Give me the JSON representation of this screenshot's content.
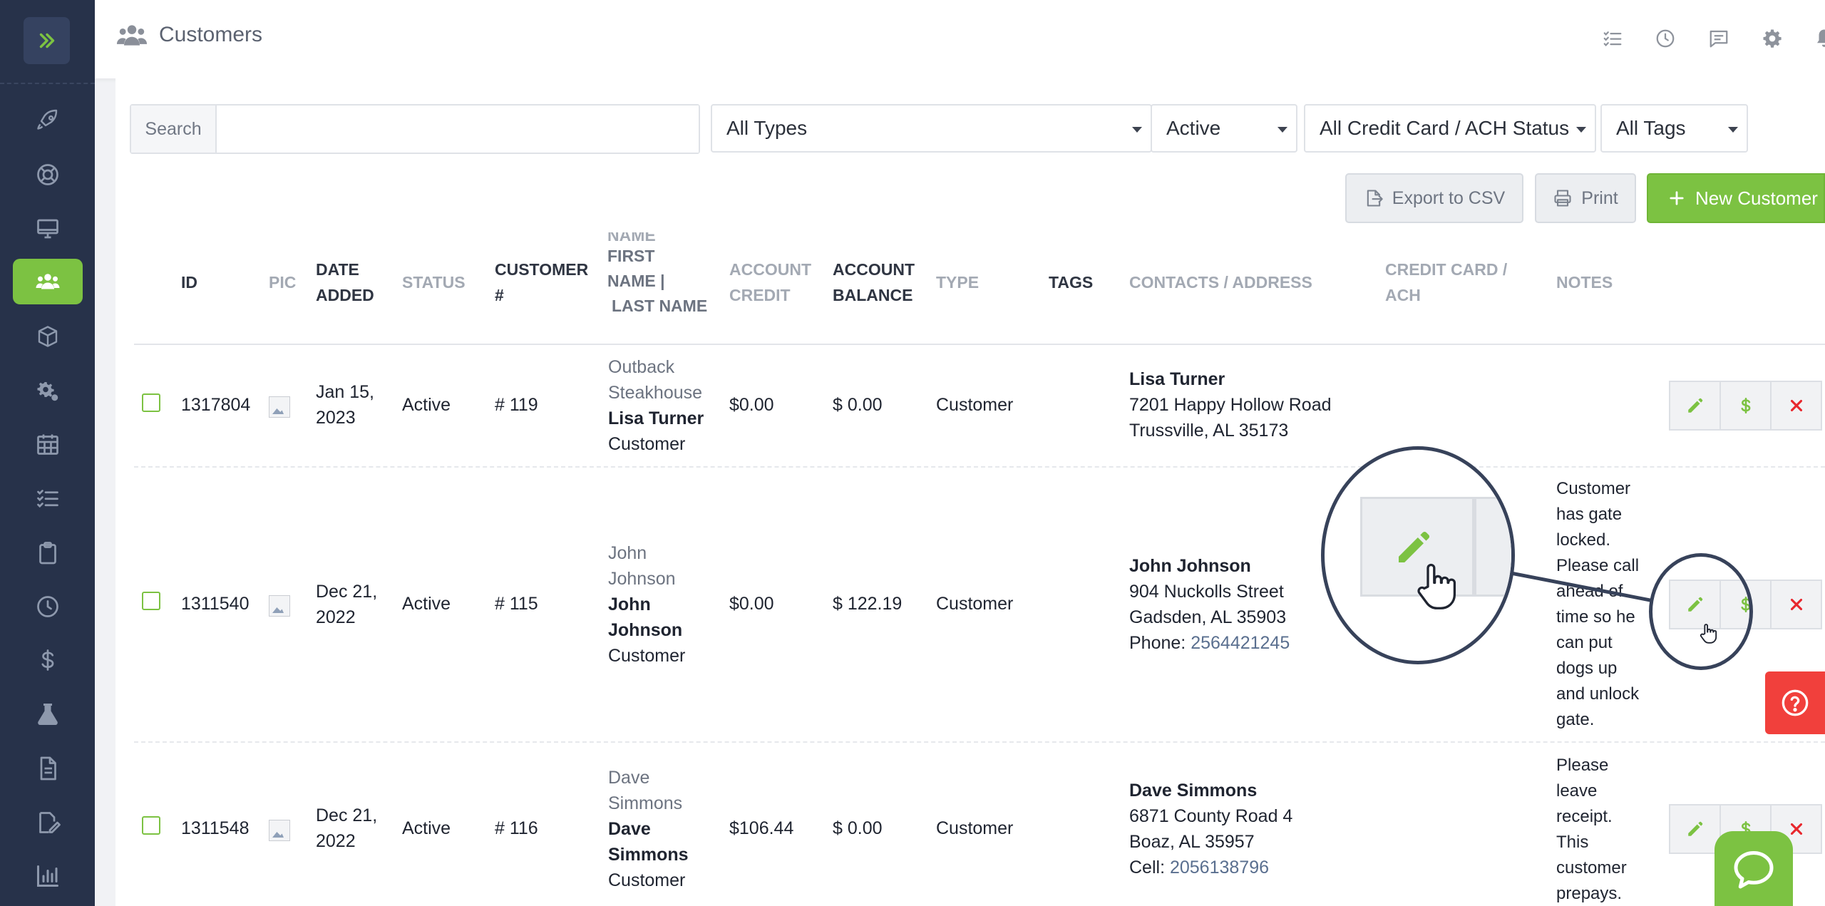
{
  "header": {
    "title": "Customers",
    "icons": [
      "checklist-icon",
      "clock-icon",
      "chat-icon",
      "gear-icon",
      "bell-icon",
      "user-icon"
    ]
  },
  "sidebar": {
    "items": [
      "rocket-icon",
      "lifebuoy-icon",
      "monitor-icon",
      "customers-icon",
      "box-icon",
      "gears-icon",
      "calendar-icon",
      "tasks-icon",
      "clipboard-icon",
      "clock-icon",
      "dollar-icon",
      "flask-icon",
      "document-icon",
      "signature-icon",
      "chart-icon"
    ],
    "active": "customers-icon"
  },
  "filters": {
    "search_label": "Search",
    "search_value": "",
    "type": "All Types",
    "status": "Active",
    "credit": "All Credit Card / ACH Status",
    "tags": "All Tags"
  },
  "toolbar": {
    "export": "Export to CSV",
    "print": "Print",
    "new_customer": "New Customer"
  },
  "table": {
    "headers": {
      "id": "ID",
      "pic": "PIC",
      "date_added_1": "DATE",
      "date_added_2": "ADDED",
      "status": "STATUS",
      "customer_1": "CUSTOMER",
      "customer_2": "#",
      "name_0": "NAME",
      "name_1": "FIRST",
      "name_2": "NAME |",
      "name_3": "LAST NAME",
      "credit_1": "ACCOUNT",
      "credit_2": "CREDIT",
      "balance_1": "ACCOUNT",
      "balance_2": "BALANCE",
      "type": "TYPE",
      "tags": "TAGS",
      "contacts": "CONTACTS / ADDRESS",
      "cc_1": "CREDIT CARD /",
      "cc_2": "ACH",
      "notes": "NOTES"
    },
    "rows": [
      {
        "id": "1317804",
        "date_1": "Jan 15,",
        "date_2": "2023",
        "status": "Active",
        "customer_no": "# 119",
        "company_1": "Outback",
        "company_2": "Steakhouse",
        "name": "Lisa Turner",
        "name_1": "",
        "name_2": "",
        "role": "Customer",
        "credit": "$0.00",
        "balance": "$ 0.00",
        "type": "Customer",
        "contact_name": "Lisa Turner",
        "street": "7201 Happy Hollow Road",
        "city": "Trussville, AL 35173",
        "phone_label": "",
        "phone": "",
        "notes": []
      },
      {
        "id": "1311540",
        "date_1": "Dec 21,",
        "date_2": "2022",
        "status": "Active",
        "customer_no": "# 115",
        "company_1": "John",
        "company_2": "Johnson",
        "name_1": "John",
        "name_2": "Johnson",
        "role": "Customer",
        "credit": "$0.00",
        "balance": "$ 122.19",
        "type": "Customer",
        "contact_name": "John Johnson",
        "street": "904 Nuckolls Street",
        "city": "Gadsden, AL 35903",
        "phone_label": "Phone:",
        "phone": "2564421245",
        "notes": [
          "Customer",
          "has gate",
          "locked.",
          "Please call",
          "ahead of",
          "time so he",
          "can put",
          "dogs up",
          "and unlock",
          "gate."
        ]
      },
      {
        "id": "1311548",
        "date_1": "Dec 21,",
        "date_2": "2022",
        "status": "Active",
        "customer_no": "# 116",
        "company_1": "Dave",
        "company_2": "Simmons",
        "name_1": "Dave",
        "name_2": "Simmons",
        "role": "Customer",
        "credit": "$106.44",
        "balance": "$ 0.00",
        "type": "Customer",
        "contact_name": "Dave Simmons",
        "street": "6871 County Road 4",
        "city": "Boaz, AL 35957",
        "phone_label": "Cell:",
        "phone": "2056138796",
        "notes": [
          "Please",
          "leave",
          "receipt.",
          "This",
          "customer",
          "prepays."
        ]
      }
    ]
  },
  "colors": {
    "accent": "#7cc242",
    "sidebar": "#27324a",
    "danger": "#f1403c"
  }
}
